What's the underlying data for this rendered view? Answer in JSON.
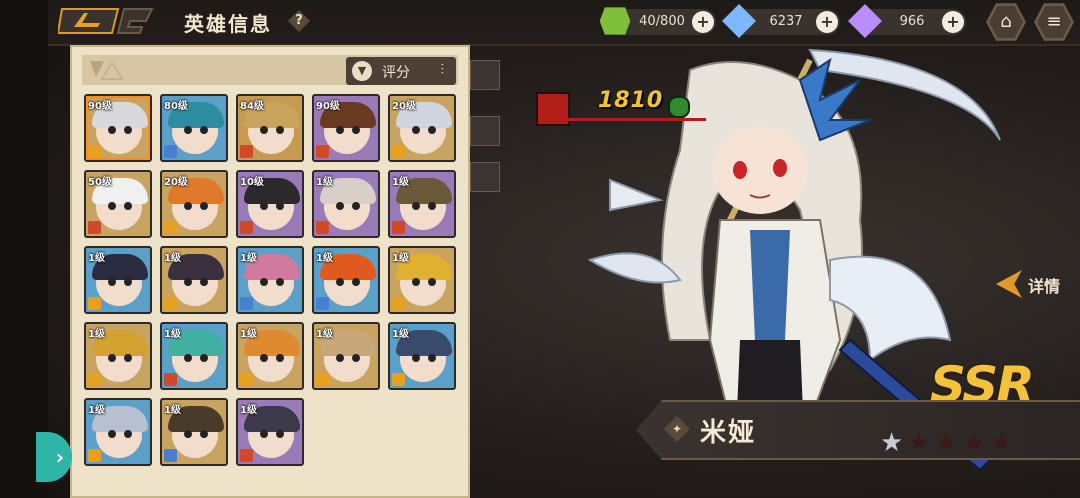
{
  "header": {
    "title": "英雄信息",
    "help": "?"
  },
  "resources": [
    {
      "name": "stamina",
      "icon": "green-cube-icon",
      "value": "40/800",
      "color": "#7fbf3a"
    },
    {
      "name": "crystal",
      "icon": "blue-crystal-icon",
      "value": "6237",
      "color": "#7fb7ff"
    },
    {
      "name": "gem",
      "icon": "purple-crystal-icon",
      "value": "966",
      "color": "#b98cff"
    }
  ],
  "panel": {
    "sort_label": "评分",
    "filter_icon": "funnel-icon"
  },
  "heroes": [
    {
      "level": "90级",
      "hair": "#d9d9dd",
      "bg": "#c8a460",
      "class_color": "#e8a020",
      "selected": true
    },
    {
      "level": "80级",
      "hair": "#2d8da0",
      "bg": "#5aa0c8",
      "class_color": "#4a7fd0",
      "selected": false
    },
    {
      "level": "84级",
      "hair": "#caa35c",
      "bg": "#c89a50",
      "class_color": "#d04a2a",
      "selected": false
    },
    {
      "level": "90级",
      "hair": "#6a3a20",
      "bg": "#9a7ab8",
      "class_color": "#d04a2a",
      "selected": false
    },
    {
      "level": "20级",
      "hair": "#cfd6e0",
      "bg": "#c8a460",
      "class_color": "#e8a020",
      "selected": false
    },
    {
      "level": "50级",
      "hair": "#f0f0f0",
      "bg": "#c8a460",
      "class_color": "#d04a2a",
      "selected": false
    },
    {
      "level": "20级",
      "hair": "#e07a2a",
      "bg": "#c8a460",
      "class_color": "#e8a020",
      "selected": false
    },
    {
      "level": "10级",
      "hair": "#2a2a2a",
      "bg": "#9a7ab8",
      "class_color": "#d04a2a",
      "selected": false
    },
    {
      "level": "1级",
      "hair": "#d8d0c8",
      "bg": "#9a7ab8",
      "class_color": "#d04a2a",
      "selected": false
    },
    {
      "level": "1级",
      "hair": "#6a5a3a",
      "bg": "#9a7ab8",
      "class_color": "#d04a2a",
      "selected": false
    },
    {
      "level": "1级",
      "hair": "#2a2a40",
      "bg": "#5aa0c8",
      "class_color": "#e8a020",
      "selected": false
    },
    {
      "level": "1级",
      "hair": "#3a3040",
      "bg": "#c8a460",
      "class_color": "#e8a020",
      "selected": false
    },
    {
      "level": "1级",
      "hair": "#d07aa0",
      "bg": "#5aa0c8",
      "class_color": "#4a7fd0",
      "selected": false
    },
    {
      "level": "1级",
      "hair": "#e05a20",
      "bg": "#5aa0c8",
      "class_color": "#4a7fd0",
      "selected": false
    },
    {
      "level": "1级",
      "hair": "#e0b030",
      "bg": "#c8a460",
      "class_color": "#e8a020",
      "selected": false
    },
    {
      "level": "1级",
      "hair": "#d4a030",
      "bg": "#c8a460",
      "class_color": "#e8a020",
      "selected": false
    },
    {
      "level": "1级",
      "hair": "#40b0a0",
      "bg": "#5aa0c8",
      "class_color": "#d04a2a",
      "selected": false
    },
    {
      "level": "1级",
      "hair": "#e08a30",
      "bg": "#c8a460",
      "class_color": "#e8a020",
      "selected": false
    },
    {
      "level": "1级",
      "hair": "#c8a878",
      "bg": "#c8a460",
      "class_color": "#e8a020",
      "selected": false
    },
    {
      "level": "1级",
      "hair": "#3a4a6a",
      "bg": "#5aa0c8",
      "class_color": "#e8a020",
      "selected": false
    },
    {
      "level": "1级",
      "hair": "#b8c0d0",
      "bg": "#5aa0c8",
      "class_color": "#e8a020",
      "selected": false
    },
    {
      "level": "1级",
      "hair": "#4a3a2a",
      "bg": "#c8a460",
      "class_color": "#4a7fd0",
      "selected": false
    },
    {
      "level": "1级",
      "hair": "#3a3a4a",
      "bg": "#9a7ab8",
      "class_color": "#d04a2a",
      "selected": false
    }
  ],
  "selected_hero": {
    "name": "米娅",
    "power": "1810",
    "rarity": "SSR",
    "stars_filled": 1,
    "stars_total": 5,
    "detail_label": "详情"
  }
}
